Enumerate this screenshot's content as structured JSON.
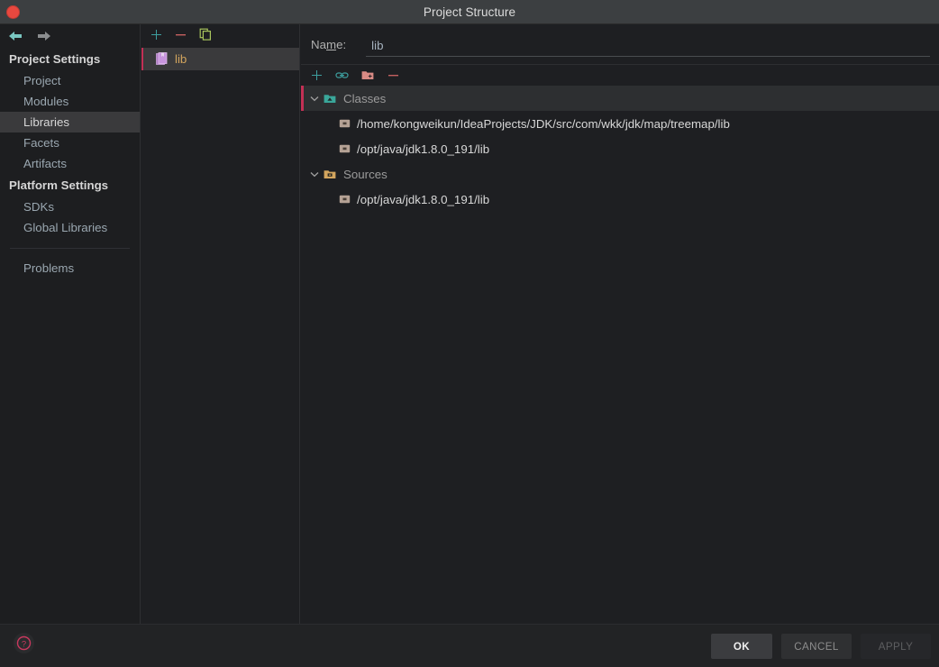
{
  "window": {
    "title": "Project Structure",
    "close_icon": "close-dot-icon"
  },
  "nav": {
    "back_icon": "arrow-left-icon",
    "forward_icon": "arrow-right-icon"
  },
  "sidebar": {
    "groups": [
      {
        "label": "Project Settings",
        "items": [
          {
            "label": "Project",
            "selected": false
          },
          {
            "label": "Modules",
            "selected": false
          },
          {
            "label": "Libraries",
            "selected": true
          },
          {
            "label": "Facets",
            "selected": false
          },
          {
            "label": "Artifacts",
            "selected": false
          }
        ]
      },
      {
        "label": "Platform Settings",
        "items": [
          {
            "label": "SDKs",
            "selected": false
          },
          {
            "label": "Global Libraries",
            "selected": false
          }
        ]
      }
    ],
    "extra": [
      {
        "label": "Problems",
        "selected": false
      }
    ]
  },
  "library_panel": {
    "toolbar": [
      {
        "name": "add-library-button",
        "icon": "plus-icon",
        "color": "#3d9e9e"
      },
      {
        "name": "remove-library-button",
        "icon": "minus-icon",
        "color": "#c4605f"
      },
      {
        "name": "copy-library-button",
        "icon": "copy-icon",
        "color": "#a8c45c"
      }
    ],
    "items": [
      {
        "label": "lib",
        "icon": "library-icon",
        "selected": true
      }
    ]
  },
  "detail": {
    "name_label_pre": "Na",
    "name_label_mnemonic": "m",
    "name_label_post": "e:",
    "name_value": "lib",
    "name_placeholder": "",
    "toolbar": [
      {
        "name": "add-root-button",
        "icon": "plus-icon",
        "color": "#3d9e9e"
      },
      {
        "name": "attach-url-button",
        "icon": "link-icon",
        "color": "#3d9e9e"
      },
      {
        "name": "add-folder-button",
        "icon": "folder-add-icon",
        "color": "#d98b85"
      },
      {
        "name": "remove-root-button",
        "icon": "minus-icon",
        "color": "#c4605f"
      }
    ],
    "tree": [
      {
        "label": "Classes",
        "icon": "classes-folder-icon",
        "icon_color": "#3aa79a",
        "expanded": true,
        "selected": true,
        "children": [
          {
            "label": "/home/kongweikun/IdeaProjects/JDK/src/com/wkk/jdk/map/treemap/lib",
            "icon": "jar-icon"
          },
          {
            "label": "/opt/java/jdk1.8.0_191/lib",
            "icon": "jar-icon"
          }
        ]
      },
      {
        "label": "Sources",
        "icon": "sources-folder-icon",
        "icon_color": "#d3a55e",
        "expanded": true,
        "selected": false,
        "children": [
          {
            "label": "/opt/java/jdk1.8.0_191/lib",
            "icon": "jar-icon"
          }
        ]
      }
    ]
  },
  "footer": {
    "help_icon": "help-circle-icon",
    "buttons": [
      {
        "label": "OK",
        "state": "default"
      },
      {
        "label": "CANCEL",
        "state": "normal"
      },
      {
        "label": "APPLY",
        "state": "disabled"
      }
    ]
  },
  "colors": {
    "accent_selection": "#c33055",
    "teal": "#3d9e9e",
    "salmon": "#c4605f",
    "title_bar": "#3c3f41",
    "background": "#1e1f22"
  }
}
